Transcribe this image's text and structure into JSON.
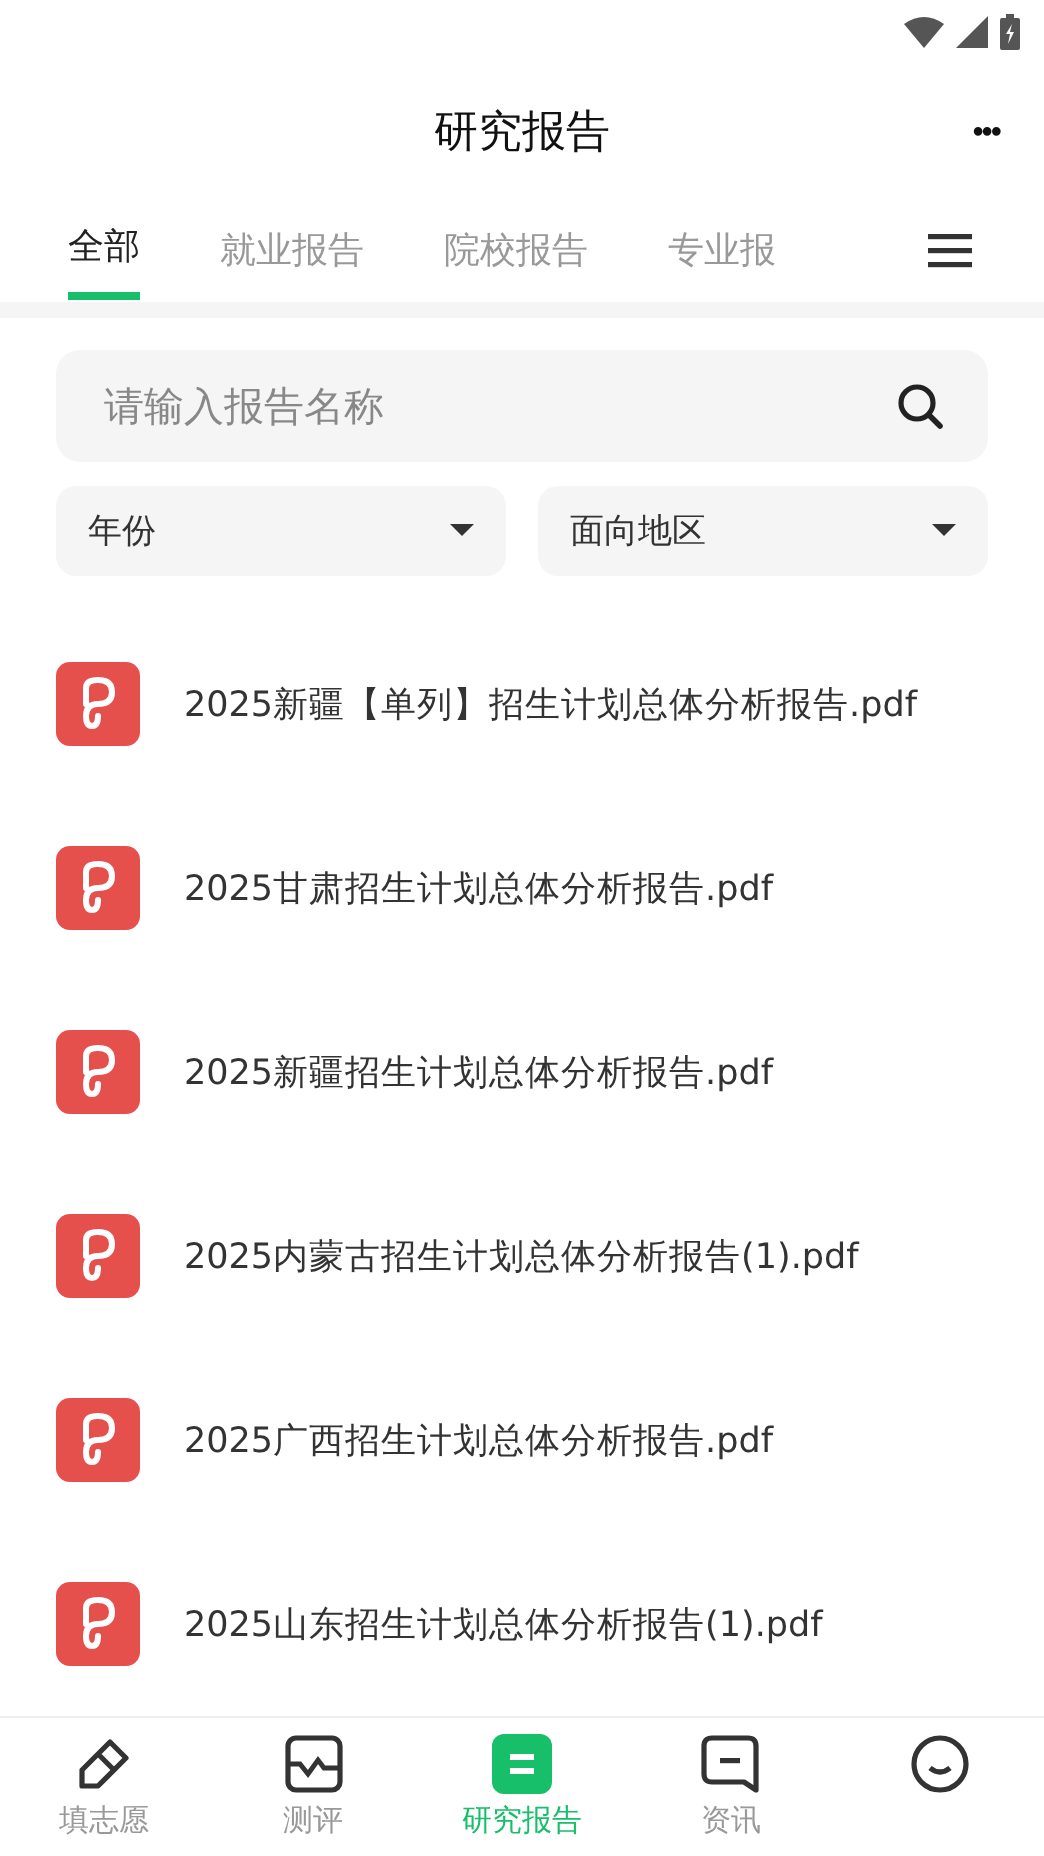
{
  "header": {
    "title": "研究报告",
    "more": "•••"
  },
  "tabs": [
    {
      "label": "全部",
      "selected": true
    },
    {
      "label": "就业报告",
      "selected": false
    },
    {
      "label": "院校报告",
      "selected": false
    },
    {
      "label": "专业报",
      "selected": false
    }
  ],
  "search": {
    "placeholder": "请输入报告名称"
  },
  "filters": [
    {
      "label": "年份"
    },
    {
      "label": "面向地区"
    }
  ],
  "reports": [
    {
      "name": "2025新疆【单列】招生计划总体分析报告.pdf"
    },
    {
      "name": "2025甘肃招生计划总体分析报告.pdf"
    },
    {
      "name": "2025新疆招生计划总体分析报告.pdf"
    },
    {
      "name": "2025内蒙古招生计划总体分析报告(1).pdf"
    },
    {
      "name": "2025广西招生计划总体分析报告.pdf"
    },
    {
      "name": "2025山东招生计划总体分析报告(1).pdf"
    }
  ],
  "nav": [
    {
      "kind": "pencil",
      "label": "填志愿",
      "selected": false
    },
    {
      "kind": "chart",
      "label": "测评",
      "selected": false
    },
    {
      "kind": "report",
      "label": "研究报告",
      "selected": true
    },
    {
      "kind": "chat",
      "label": "资讯",
      "selected": false
    },
    {
      "kind": "user",
      "selected": false
    }
  ]
}
